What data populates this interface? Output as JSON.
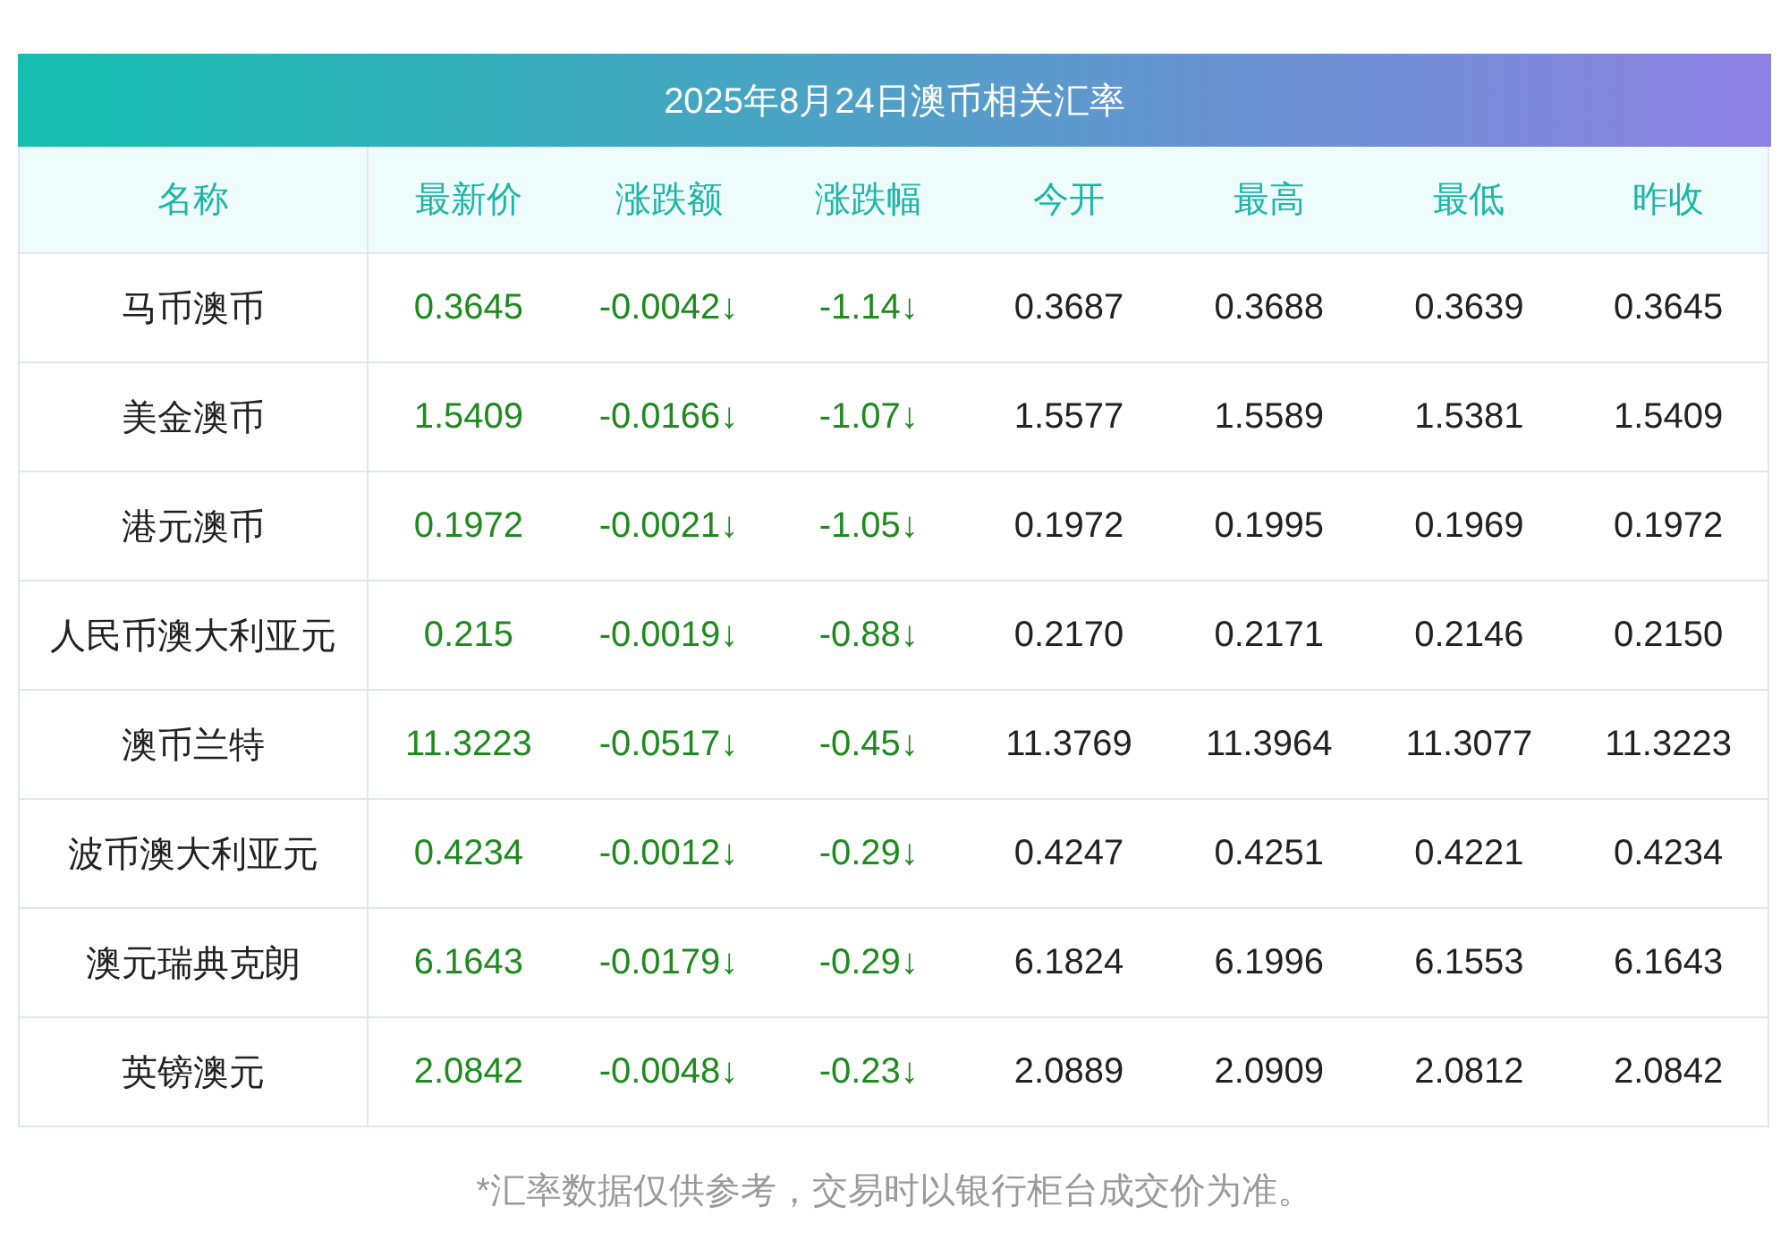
{
  "table": {
    "title": "2025年8月24日澳币相关汇率",
    "columns": [
      "名称",
      "最新价",
      "涨跌额",
      "涨跌幅",
      "今开",
      "最高",
      "最低",
      "昨收"
    ],
    "rows": [
      {
        "falling": true,
        "cells": [
          "马币澳币",
          "0.3645",
          "-0.0042↓",
          "-1.14↓",
          "0.3687",
          "0.3688",
          "0.3639",
          "0.3645"
        ]
      },
      {
        "falling": true,
        "cells": [
          "美金澳币",
          "1.5409",
          "-0.0166↓",
          "-1.07↓",
          "1.5577",
          "1.5589",
          "1.5381",
          "1.5409"
        ]
      },
      {
        "falling": true,
        "cells": [
          "港元澳币",
          "0.1972",
          "-0.0021↓",
          "-1.05↓",
          "0.1972",
          "0.1995",
          "0.1969",
          "0.1972"
        ]
      },
      {
        "falling": true,
        "cells": [
          "人民币澳大利亚元",
          "0.215",
          "-0.0019↓",
          "-0.88↓",
          "0.2170",
          "0.2171",
          "0.2146",
          "0.2150"
        ]
      },
      {
        "falling": true,
        "cells": [
          "澳币兰特",
          "11.3223",
          "-0.0517↓",
          "-0.45↓",
          "11.3769",
          "11.3964",
          "11.3077",
          "11.3223"
        ]
      },
      {
        "falling": true,
        "cells": [
          "波币澳大利亚元",
          "0.4234",
          "-0.0012↓",
          "-0.29↓",
          "0.4247",
          "0.4251",
          "0.4221",
          "0.4234"
        ]
      },
      {
        "falling": true,
        "cells": [
          "澳元瑞典克朗",
          "6.1643",
          "-0.0179↓",
          "-0.29↓",
          "6.1824",
          "6.1996",
          "6.1553",
          "6.1643"
        ]
      },
      {
        "falling": true,
        "cells": [
          "英镑澳元",
          "2.0842",
          "-0.0048↓",
          "-0.23↓",
          "2.0889",
          "2.0909",
          "2.0812",
          "2.0842"
        ]
      }
    ]
  },
  "footnote": "*汇率数据仅供参考，交易时以银行柜台成交价为准。"
}
